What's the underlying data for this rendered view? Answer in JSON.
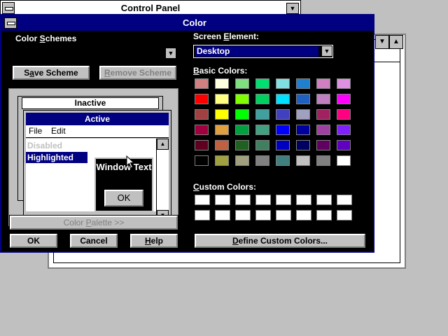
{
  "control_panel": {
    "title": "Control Panel"
  },
  "dialog": {
    "title": "Color",
    "color_schemes_label": "Color Schemes",
    "save_scheme": "Save Scheme",
    "remove_scheme": "Remove Scheme",
    "screen_element_label": "Screen Element:",
    "screen_element_value": "Desktop",
    "basic_colors_label": "Basic Colors:",
    "custom_colors_label": "Custom Colors:",
    "color_palette_button": "Color Palette >>",
    "ok_button": "OK",
    "cancel_button": "Cancel",
    "help_button": "Help",
    "define_custom_colors": "Define Custom Colors..."
  },
  "preview": {
    "inactive_title": "Inactive",
    "active_title": "Active",
    "menu_file": "File",
    "menu_edit": "Edit",
    "disabled_text": "Disabled",
    "highlighted_text": "Highlighted",
    "window_text": "Window Text",
    "ok": "OK"
  },
  "basic_colors": [
    "#d08080",
    "#ffffe0",
    "#80e080",
    "#00e070",
    "#80e0e0",
    "#2080d0",
    "#d080c0",
    "#e090e0",
    "#ff0000",
    "#ffff80",
    "#80ff00",
    "#00d060",
    "#00e0ff",
    "#2060c0",
    "#c080c0",
    "#ff00ff",
    "#a04040",
    "#ffff00",
    "#00ff00",
    "#40a0a0",
    "#4040c0",
    "#a0a0c0",
    "#a02060",
    "#ff0080",
    "#a00040",
    "#e0a040",
    "#00a040",
    "#40a080",
    "#0000ff",
    "#0000a0",
    "#a040a0",
    "#8020ff",
    "#600020",
    "#c06040",
    "#206020",
    "#408060",
    "#0000c0",
    "#000060",
    "#600060",
    "#6000c0",
    "#000000",
    "#a0a040",
    "#a0a080",
    "#808080",
    "#408080",
    "#c0c0c0",
    "#808080",
    "#ffffff"
  ],
  "colors": {
    "dialog_bg": "#000000",
    "titlebar": "#000080",
    "desktop": "#c0c0c0"
  }
}
